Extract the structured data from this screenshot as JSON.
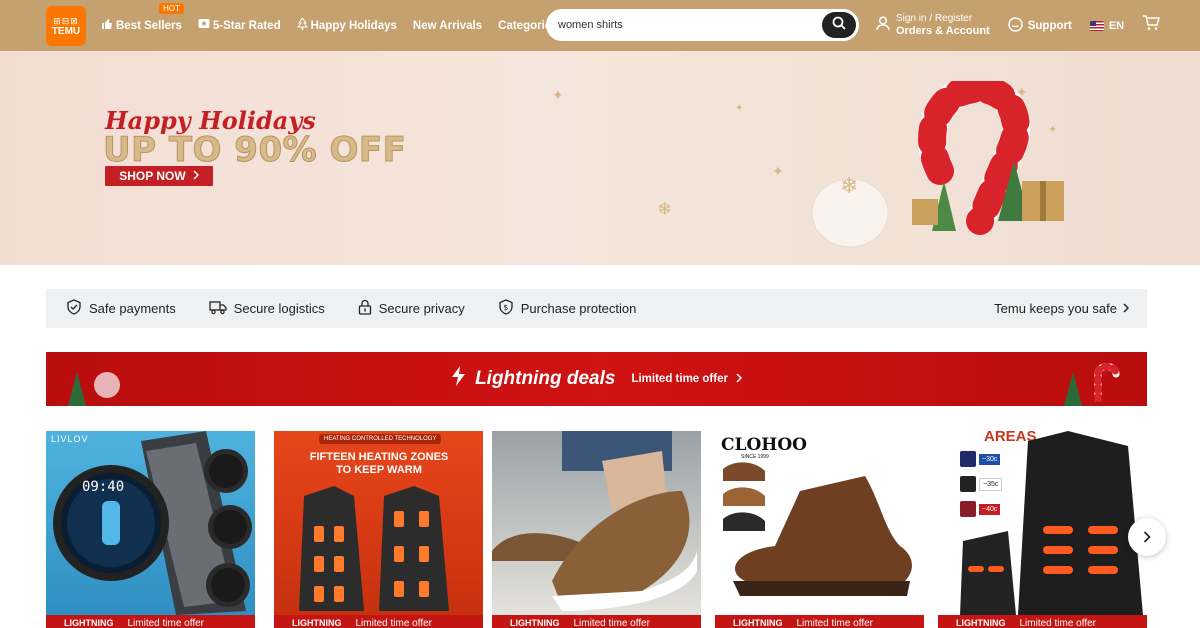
{
  "header": {
    "logo_text": "TEMU",
    "nav": [
      {
        "label": "Best Sellers",
        "icon": "thumbs-up-icon",
        "badge": "HOT"
      },
      {
        "label": "5-Star Rated",
        "icon": "star-rated-icon"
      },
      {
        "label": "Happy Holidays",
        "icon": "tree-icon"
      },
      {
        "label": "New Arrivals"
      },
      {
        "label": "Categories",
        "icon": "chevron-down-icon"
      }
    ],
    "search": {
      "value": "women shirts"
    },
    "account": {
      "line1": "Sign in / Register",
      "line2": "Orders & Account"
    },
    "support": "Support",
    "language": "EN"
  },
  "hero": {
    "script_title": "Happy Holidays",
    "headline": "UP TO 90% OFF",
    "cta": "SHOP NOW"
  },
  "safety": {
    "items": [
      {
        "label": "Safe payments",
        "icon": "shield-check-icon"
      },
      {
        "label": "Secure logistics",
        "icon": "truck-icon"
      },
      {
        "label": "Secure privacy",
        "icon": "lock-icon"
      },
      {
        "label": "Purchase protection",
        "icon": "shield-dollar-icon"
      }
    ],
    "link": "Temu keeps you safe"
  },
  "lightning": {
    "title": "Lightning deals",
    "subtitle": "Limited time offer"
  },
  "products": [
    {
      "name": "smartwatch",
      "brand": "LIVLOV",
      "strip_label": "LIGHTNING",
      "strip_offer": "Limited time offer"
    },
    {
      "name": "heated-vest",
      "tag": "HEATING CONTROLLED TECHNOLOGY",
      "headline": "FIFTEEN HEATING ZONES TO KEEP WARM",
      "strip_label": "LIGHTNING",
      "strip_offer": "Limited time offer"
    },
    {
      "name": "slip-on-shoe",
      "strip_label": "LIGHTNING",
      "strip_offer": "Limited time offer"
    },
    {
      "name": "leather-boot",
      "brand": "CLOHOO",
      "brand_sub": "SINCE 1999",
      "strip_label": "LIGHTNING",
      "strip_offer": "Limited time offer"
    },
    {
      "name": "heated-vest-2",
      "headline": "AREAS",
      "levels": [
        "~30c",
        "~35c",
        "~40c"
      ],
      "strip_label": "LIGHTNING",
      "strip_offer": "Limited time offer"
    }
  ],
  "colors": {
    "header": "#c4a16f",
    "accent": "#fb7701",
    "deal_red": "#c41414"
  }
}
